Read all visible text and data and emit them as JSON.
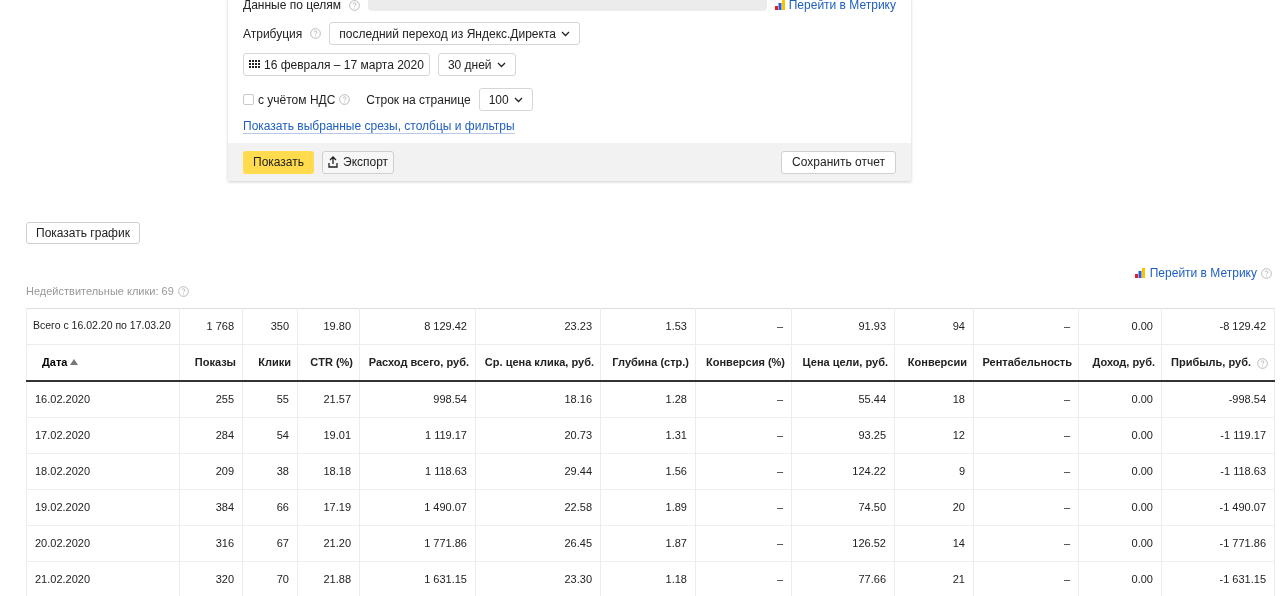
{
  "form": {
    "goals": {
      "label": "Данные по целям",
      "metrika_link": "Перейти в Метрику"
    },
    "attribution": {
      "label": "Атрибуция",
      "value": "последний переход из Яндекс.Директа"
    },
    "date_range": "16 февраля – 17 марта 2020",
    "period": "30 дней",
    "vat": {
      "label": "с учётом НДС",
      "checked": false
    },
    "rows_per_page": {
      "label": "Строк на странице",
      "value": "100"
    },
    "slices_link": "Показать выбранные срезы, столбцы и фильтры",
    "buttons": {
      "show": "Показать",
      "export": "Экспорт",
      "save": "Сохранить отчет"
    }
  },
  "show_chart_button": "Показать график",
  "invalid_clicks": "Недействительные клики: 69",
  "metrika_link": "Перейти в Метрику",
  "table": {
    "totals": [
      "Всего с 16.02.20 по 17.03.20",
      "1 768",
      "350",
      "19.80",
      "8 129.42",
      "23.23",
      "1.53",
      "–",
      "91.93",
      "94",
      "–",
      "0.00",
      "-8 129.42"
    ],
    "columns": [
      {
        "label": "Дата",
        "sorted": true
      },
      {
        "label": "Показы",
        "sorted": false
      },
      {
        "label": "Клики",
        "sorted": false
      },
      {
        "label": "CTR (%)",
        "sorted": false
      },
      {
        "label": "Расход всего, руб.",
        "sorted": false
      },
      {
        "label": "Ср. цена клика, руб.",
        "sorted": false
      },
      {
        "label": "Глубина (стр.)",
        "sorted": false
      },
      {
        "label": "Конверсия (%)",
        "sorted": false
      },
      {
        "label": "Цена цели, руб.",
        "sorted": false
      },
      {
        "label": "Конверсии",
        "sorted": false
      },
      {
        "label": "Рентабельность",
        "sorted": false
      },
      {
        "label": "Доход, руб.",
        "sorted": false
      },
      {
        "label": "Прибыль, руб.",
        "sorted": false
      }
    ],
    "rows": [
      [
        "16.02.2020",
        "255",
        "55",
        "21.57",
        "998.54",
        "18.16",
        "1.28",
        "–",
        "55.44",
        "18",
        "–",
        "0.00",
        "-998.54"
      ],
      [
        "17.02.2020",
        "284",
        "54",
        "19.01",
        "1 119.17",
        "20.73",
        "1.31",
        "–",
        "93.25",
        "12",
        "–",
        "0.00",
        "-1 119.17"
      ],
      [
        "18.02.2020",
        "209",
        "38",
        "18.18",
        "1 118.63",
        "29.44",
        "1.56",
        "–",
        "124.22",
        "9",
        "–",
        "0.00",
        "-1 118.63"
      ],
      [
        "19.02.2020",
        "384",
        "66",
        "17.19",
        "1 490.07",
        "22.58",
        "1.89",
        "–",
        "74.50",
        "20",
        "–",
        "0.00",
        "-1 490.07"
      ],
      [
        "20.02.2020",
        "316",
        "67",
        "21.20",
        "1 771.86",
        "26.45",
        "1.87",
        "–",
        "126.52",
        "14",
        "–",
        "0.00",
        "-1 771.86"
      ],
      [
        "21.02.2020",
        "320",
        "70",
        "21.88",
        "1 631.15",
        "23.30",
        "1.18",
        "–",
        "77.66",
        "21",
        "–",
        "0.00",
        "-1 631.15"
      ]
    ]
  }
}
